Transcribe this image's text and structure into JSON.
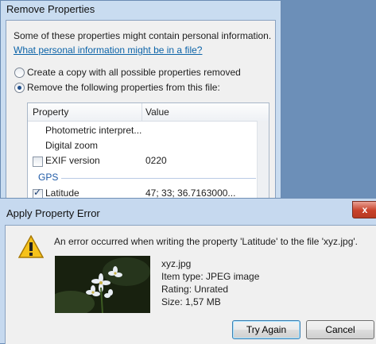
{
  "remove_properties": {
    "title": "Remove Properties",
    "intro": "Some of these properties might contain personal information.",
    "link": "What personal information might be in a file?",
    "option_copy": "Create a copy with all possible properties removed",
    "option_remove": "Remove the following properties from this file:",
    "selected_option": "remove",
    "columns": [
      "Property",
      "Value"
    ],
    "rows": [
      {
        "property": "Photometric interpret...",
        "value": "",
        "has_checkbox": false,
        "checked": false
      },
      {
        "property": "Digital zoom",
        "value": "",
        "has_checkbox": false,
        "checked": false
      },
      {
        "property": "EXIF version",
        "value": "0220",
        "has_checkbox": true,
        "checked": false
      }
    ],
    "group": "GPS",
    "gps_row": {
      "property": "Latitude",
      "value": "47; 33; 36.7163000...",
      "checked": true
    }
  },
  "error_dialog": {
    "title": "Apply Property Error",
    "close_label": "x",
    "message": "An error occurred when writing the property 'Latitude' to the file 'xyz.jpg'.",
    "file_name": "xyz.jpg",
    "item_type": "Item type: JPEG image",
    "rating": "Rating: Unrated",
    "size": "Size: 1,57 MB",
    "try_again": "Try Again",
    "cancel": "Cancel"
  },
  "icons": {
    "warning": "warning-icon",
    "close": "close-icon"
  },
  "colors": {
    "accent": "#0b63a8",
    "close_button": "#c8412a",
    "warning": "#f6c21b"
  }
}
